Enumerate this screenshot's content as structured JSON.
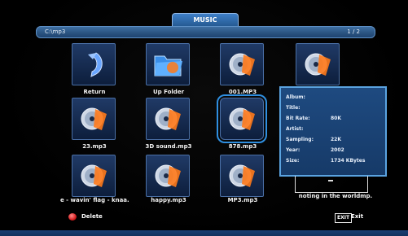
{
  "header": {
    "title": "MUSIC"
  },
  "path_bar": {
    "path": "C:\\mp3",
    "page": "1 / 2"
  },
  "grid": [
    {
      "label": "Return",
      "icon": "return-arrow-icon"
    },
    {
      "label": "Up Folder",
      "icon": "folder-icon"
    },
    {
      "label": "001.MP3",
      "icon": "music-cd-icon"
    },
    {
      "label": "",
      "icon": "music-cd-icon"
    },
    {
      "label": "23.mp3",
      "icon": "music-cd-icon"
    },
    {
      "label": "3D sound.mp3",
      "icon": "music-cd-icon"
    },
    {
      "label": "878.mp3",
      "icon": "music-cd-icon",
      "selected": true
    },
    {
      "label": "e - wavin' flag - knaa.",
      "icon": "music-cd-icon"
    },
    {
      "label": "happy.mp3",
      "icon": "music-cd-icon"
    },
    {
      "label": "MP3.mp3",
      "icon": "music-cd-icon"
    }
  ],
  "info": {
    "album": {
      "label": "Album:",
      "value": ""
    },
    "title": {
      "label": "Title:",
      "value": ""
    },
    "bitrate": {
      "label": "Bit Rate:",
      "value": "80K"
    },
    "artist": {
      "label": "Artist:",
      "value": ""
    },
    "sampling": {
      "label": "Sampling:",
      "value": "22K"
    },
    "year": {
      "label": "Year:",
      "value": "2002"
    },
    "size": {
      "label": "Size:",
      "value": "1734 KBytes"
    }
  },
  "now_playing_marquee": "noting in the worldmp.",
  "footer": {
    "delete_label": "Delete",
    "exit_key": "EXIT",
    "exit_label": "Exit"
  },
  "colors": {
    "accent": "#2f8fe0",
    "panel": "#1e4a80",
    "delete": "#d41f1f"
  }
}
